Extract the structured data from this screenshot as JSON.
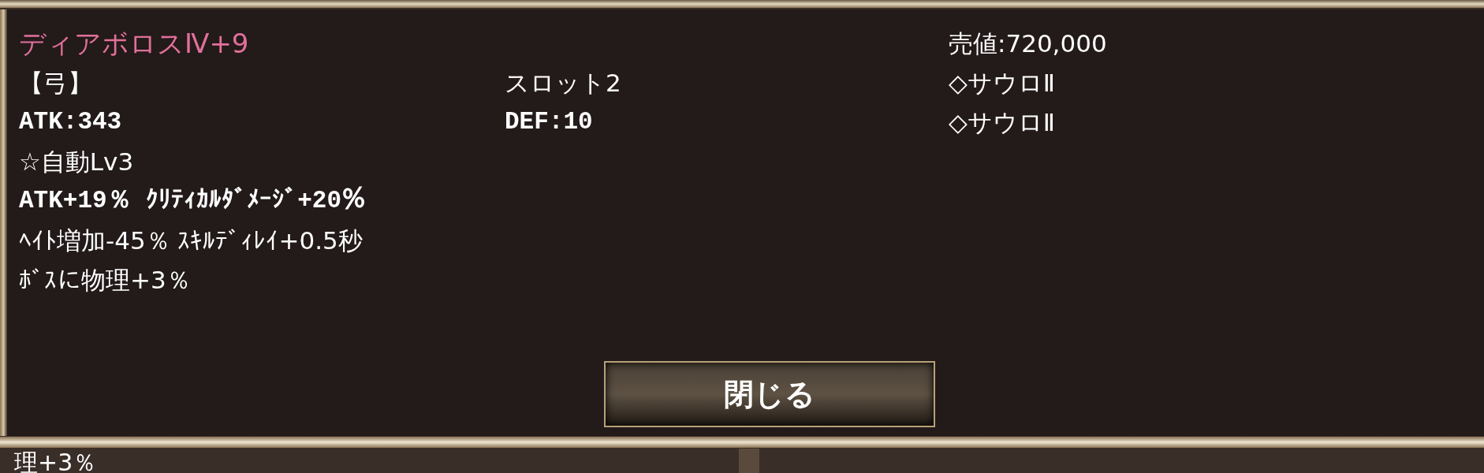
{
  "item": {
    "name": "ディアボロスⅣ+9",
    "lines": [
      "【弓】",
      "ATK:343",
      "☆自動Lv3",
      "ATK+19％ ｸﾘﾃｨｶﾙﾀﾞﾒｰｼﾞ+20％",
      "ﾍｲﾄ増加-45％ ｽｷﾙﾃﾞｨﾚｲ+0.5秒",
      "ﾎﾞｽに物理+3％"
    ],
    "middle_lines": [
      "スロット2",
      "DEF:10"
    ],
    "sell_price": "売値:720,000",
    "slots": [
      "◇サウロⅡ",
      "◇サウロⅡ"
    ]
  },
  "close_button": "閉じる",
  "background_text": "理+3％"
}
